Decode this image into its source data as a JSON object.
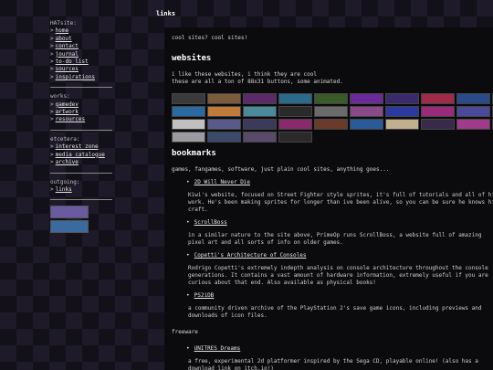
{
  "page_title": "links",
  "sidebar": {
    "sections": [
      {
        "head": "HATsite:",
        "items": [
          "home",
          "about",
          "contact",
          "journal",
          "to-do list",
          "sources",
          "inspirations"
        ]
      },
      {
        "head": "works:",
        "items": [
          "gamedev",
          "artwork",
          "resources"
        ]
      },
      {
        "head": "etcetera:",
        "items": [
          "interest zone",
          "media catalogue",
          "archive"
        ]
      },
      {
        "head": "outgoing:",
        "items": [
          "links"
        ]
      }
    ],
    "arrow": ">"
  },
  "main": {
    "tagline": "cool sites? cool sites!",
    "websites": {
      "heading": "websites",
      "line1": "i like these websites, i think they are cool",
      "line2": "these are all a ton of 88x31 buttons, some animated.",
      "buttons": [
        {
          "label": "",
          "color": "#3a3a3a"
        },
        {
          "label": "",
          "color": "#7a5c3a"
        },
        {
          "label": "",
          "color": "#5a2a6a"
        },
        {
          "label": "",
          "color": "#2a6a8a"
        },
        {
          "label": "",
          "color": "#3a5a2a"
        },
        {
          "label": "",
          "color": "#6a2a9a"
        },
        {
          "label": "",
          "color": "#3a2a6a"
        },
        {
          "label": "",
          "color": "#a02a4a"
        },
        {
          "label": "",
          "color": "#2a4a8a"
        },
        {
          "label": "",
          "color": "#5a9a3a"
        },
        {
          "label": "",
          "color": "#2a6aa0"
        },
        {
          "label": "",
          "color": "#c07a3a"
        },
        {
          "label": "",
          "color": "#4a8a9a"
        },
        {
          "label": "",
          "color": "#2a2a2a"
        },
        {
          "label": "",
          "color": "#6a6a6a"
        },
        {
          "label": "",
          "color": "#8a4a8a"
        },
        {
          "label": "",
          "color": "#2a3aa0"
        },
        {
          "label": "",
          "color": "#9a2a7a"
        },
        {
          "label": "",
          "color": "#4a4a9a"
        },
        {
          "label": "",
          "color": "#2a2a3a"
        },
        {
          "label": "",
          "color": "#c0c0c0"
        },
        {
          "label": "",
          "color": "#5a5a8a"
        },
        {
          "label": "",
          "color": "#3a3a5a"
        },
        {
          "label": "",
          "color": "#8a2a6a"
        },
        {
          "label": "",
          "color": "#6a3a2a"
        },
        {
          "label": "",
          "color": "#2a5a9a"
        },
        {
          "label": "",
          "color": "#c0b090"
        },
        {
          "label": "",
          "color": "#3a2a4a"
        },
        {
          "label": "",
          "color": "#a03a8a"
        },
        {
          "label": "",
          "color": "#2a6a4a"
        },
        {
          "label": "",
          "color": "#9a9aa0"
        },
        {
          "label": "",
          "color": "#3a4a6a"
        },
        {
          "label": "",
          "color": "#5a4a6a"
        },
        {
          "label": "",
          "color": "#2a2a2a"
        }
      ]
    },
    "bookmarks": {
      "heading": "bookmarks",
      "intro": "games, fangames, software, just plain cool sites, anything goes...",
      "items": [
        {
          "title": "2D Will Never Die",
          "desc": "Kiwi's website, focused on Street Fighter style sprites, it's full of tutorials and all of his work. He's been making sprites for longer than ive been alive, so you can be sure he knows his craft."
        },
        {
          "title": "ScrollBoss",
          "desc": "in a similar nature to the site above, PrimeOp runs ScrollBoss, a website full of amazing pixel art and all sorts of info on older games."
        },
        {
          "title": "Copetti's Architecture of Consoles",
          "desc": "Rodrigo Copetti's extremely indepth analysis on console architecture throughout the console generations. It contains a vast amount of hardware information, extremely useful if you are curious about that end. Also available as physical books!"
        },
        {
          "title": "PS2iDB",
          "desc": "a community driven archive of the PlayStation 2's save game icons, including previews and downloads of icon files."
        }
      ],
      "freeware_label": "freeware",
      "freeware_items": [
        {
          "title": "UNITRES Dreams",
          "desc": "a free, experimental 2d platformer inspired by the Sega CD, playable online! (also has a download link on itch.io!)"
        }
      ]
    }
  }
}
